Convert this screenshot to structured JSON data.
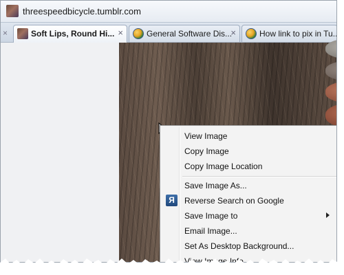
{
  "browser": {
    "url": "threespeedbicycle.tumblr.com",
    "tabs": [
      {
        "label": "Soft Lips, Round Hi...",
        "active": true,
        "favicon": "photo-thumbnail-icon"
      },
      {
        "label": "General Software Dis...",
        "active": false,
        "favicon": "globe-icon"
      },
      {
        "label": "How link to pix in Tu...",
        "active": false,
        "favicon": "globe-icon"
      }
    ],
    "close_glyph": "×",
    "scroll_glyph": "×"
  },
  "context_menu": {
    "items": [
      {
        "label": "View Image"
      },
      {
        "label": "Copy Image"
      },
      {
        "label": "Copy Image Location"
      },
      {
        "label": "Save Image As..."
      },
      {
        "label": "Reverse Search on Google",
        "icon_letter": "Я"
      },
      {
        "label": "Save Image to",
        "submenu": true
      },
      {
        "label": "Email Image..."
      },
      {
        "label": "Set As Desktop Background..."
      },
      {
        "label": "View Image Info"
      }
    ]
  },
  "colors": {
    "accent": "#3d6ea8",
    "tab_border": "#9fadc0",
    "menu_bg": "#f3f3f3"
  }
}
